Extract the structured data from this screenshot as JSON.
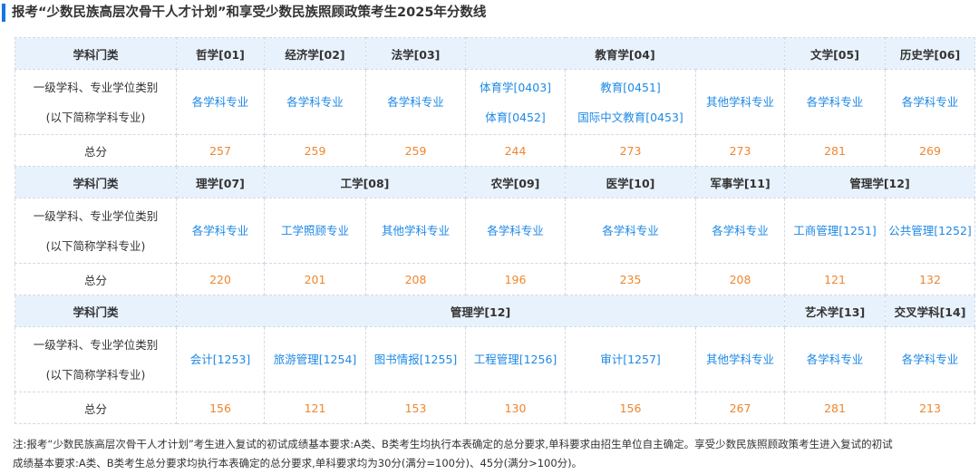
{
  "title": "报考“少数民族高层次骨干人才计划”和享受少数民族照顾政策考生2025年分数线",
  "row_labels": {
    "category": "学科门类",
    "major_line1": "一级学科、专业学位类别",
    "major_line2": "(以下简称学科专业)",
    "score": "总分"
  },
  "block1": {
    "categories": [
      "哲学[01]",
      "经济学[02]",
      "法学[03]",
      "教育学[04]",
      "文学[05]",
      "历史学[06]"
    ],
    "majors": [
      [
        "各学科专业"
      ],
      [
        "各学科专业"
      ],
      [
        "各学科专业"
      ],
      [
        "体育学[0403]",
        "体育[0452]"
      ],
      [
        "教育[0451]",
        "国际中文教育[0453]"
      ],
      [
        "其他学科专业"
      ],
      [
        "各学科专业"
      ],
      [
        "各学科专业"
      ]
    ],
    "scores": [
      "257",
      "259",
      "259",
      "244",
      "273",
      "273",
      "281",
      "269"
    ]
  },
  "block2": {
    "categories": [
      "理学[07]",
      "工学[08]",
      "农学[09]",
      "医学[10]",
      "军事学[11]",
      "管理学[12]"
    ],
    "majors": [
      "各学科专业",
      "工学照顾专业",
      "其他学科专业",
      "各学科专业",
      "各学科专业",
      "各学科专业",
      "工商管理[1251]",
      "公共管理[1252]"
    ],
    "scores": [
      "220",
      "201",
      "208",
      "196",
      "235",
      "208",
      "121",
      "132"
    ]
  },
  "block3": {
    "categories": [
      "管理学[12]",
      "艺术学[13]",
      "交叉学科[14]"
    ],
    "majors": [
      "会计[1253]",
      "旅游管理[1254]",
      "图书情报[1255]",
      "工程管理[1256]",
      "审计[1257]",
      "其他学科专业",
      "各学科专业",
      "各学科专业"
    ],
    "scores": [
      "156",
      "121",
      "153",
      "130",
      "156",
      "267",
      "281",
      "213"
    ]
  },
  "note": {
    "line1": "注:报考“少数民族高层次骨干人才计划”考生进入复试的初试成绩基本要求:A类、B类考生均执行本表确定的总分要求,单科要求由招生单位自主确定。享受少数民族照顾政策考生进入复试的初试",
    "line2": "成绩基本要求:A类、B类考生总分要求均执行本表确定的总分要求,单科要求均为30分(满分=100分)、45分(满分>100分)。"
  }
}
